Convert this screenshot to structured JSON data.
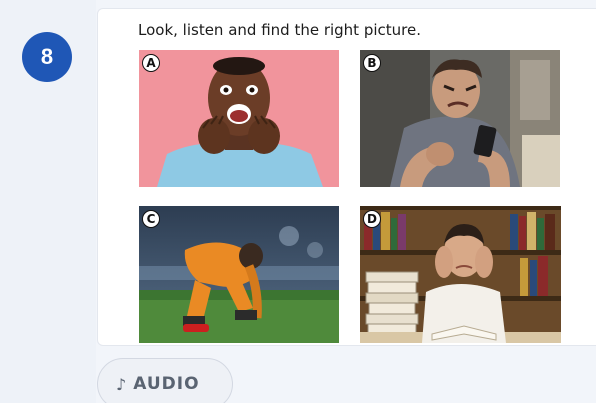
{
  "question": {
    "number": "8",
    "instruction": "Look, listen and find the right picture."
  },
  "options": [
    {
      "letter": "A",
      "icon": "excited-man-photo"
    },
    {
      "letter": "B",
      "icon": "angry-man-with-phone-photo"
    },
    {
      "letter": "C",
      "icon": "sad-footballer-photo"
    },
    {
      "letter": "D",
      "icon": "stressed-student-with-books-photo"
    }
  ],
  "audio": {
    "icon": "music-note-icon",
    "note_glyph": "♪",
    "label": "AUDIO"
  },
  "colors": {
    "badge": "#1f57b6",
    "card": "#ffffff",
    "background": "#f2f5fa",
    "audio_text": "#5a6472"
  }
}
